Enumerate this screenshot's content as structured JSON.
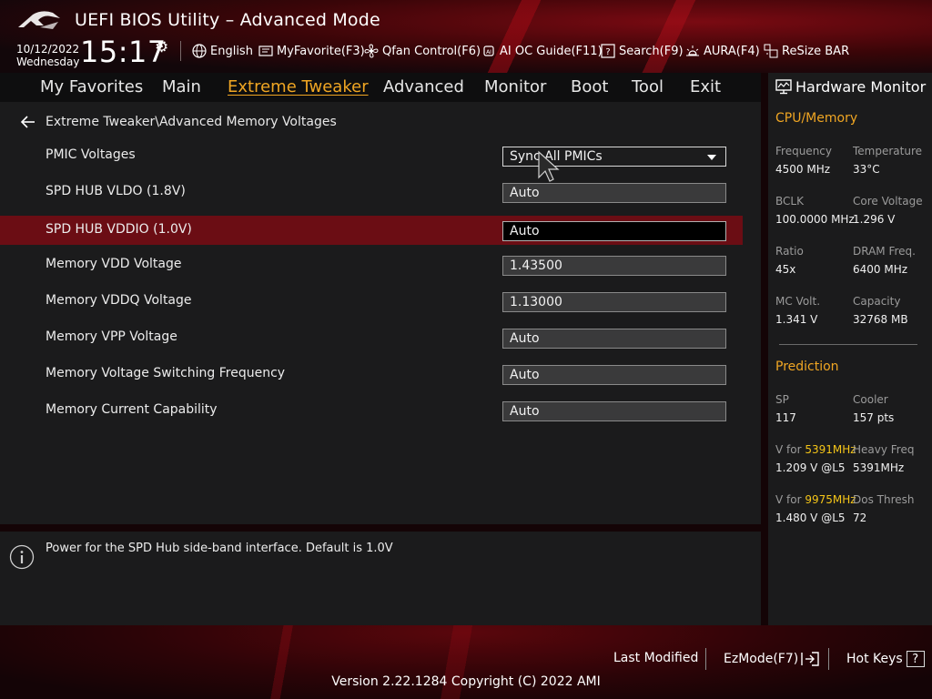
{
  "app": {
    "title": "UEFI BIOS Utility – Advanced Mode"
  },
  "header": {
    "date": "10/12/2022",
    "day": "Wednesday",
    "time": "15:17",
    "toolbar": [
      {
        "label": "English",
        "icon": "globe-icon"
      },
      {
        "label": "MyFavorite(F3)",
        "icon": "favorite-icon"
      },
      {
        "label": "Qfan Control(F6)",
        "icon": "fan-icon"
      },
      {
        "label": "AI OC Guide(F11)",
        "icon": "ai-chip-icon"
      },
      {
        "label": "Search(F9)",
        "icon": "search-help-icon"
      },
      {
        "label": "AURA(F4)",
        "icon": "aura-light-icon"
      },
      {
        "label": "ReSize BAR",
        "icon": "resize-bar-icon"
      }
    ]
  },
  "nav": {
    "tabs": [
      {
        "label": "My Favorites"
      },
      {
        "label": "Main"
      },
      {
        "label": "Extreme Tweaker",
        "active": true
      },
      {
        "label": "Advanced"
      },
      {
        "label": "Monitor"
      },
      {
        "label": "Boot"
      },
      {
        "label": "Tool"
      },
      {
        "label": "Exit"
      }
    ]
  },
  "main": {
    "breadcrumb": "Extreme Tweaker\\Advanced Memory Voltages",
    "settings": [
      {
        "label": "PMIC Voltages",
        "value": "Sync All PMICs",
        "type": "dropdown"
      },
      {
        "label": "SPD HUB VLDO (1.8V)",
        "value": "Auto"
      },
      {
        "label": "SPD HUB VDDIO (1.0V)",
        "value": "Auto",
        "selected": true
      },
      {
        "label": "Memory VDD Voltage",
        "value": "1.43500"
      },
      {
        "label": "Memory VDDQ Voltage",
        "value": "1.13000"
      },
      {
        "label": "Memory VPP Voltage",
        "value": "Auto"
      },
      {
        "label": "Memory Voltage Switching Frequency",
        "value": "Auto"
      },
      {
        "label": "Memory Current Capability",
        "value": "Auto"
      }
    ]
  },
  "help": {
    "text": "Power for the SPD Hub side-band interface. Default is 1.0V"
  },
  "hardware_monitor": {
    "title": "Hardware Monitor",
    "cpu_memory": {
      "heading": "CPU/Memory",
      "frequency_label": "Frequency",
      "frequency": "4500 MHz",
      "temperature_label": "Temperature",
      "temperature": "33°C",
      "bclk_label": "BCLK",
      "bclk": "100.0000 MHz",
      "core_voltage_label": "Core Voltage",
      "core_voltage": "1.296 V",
      "ratio_label": "Ratio",
      "ratio": "45x",
      "dram_freq_label": "DRAM Freq.",
      "dram_freq": "6400 MHz",
      "mc_volt_label": "MC Volt.",
      "mc_volt": "1.341 V",
      "capacity_label": "Capacity",
      "capacity": "32768 MB"
    },
    "prediction": {
      "heading": "Prediction",
      "sp_label": "SP",
      "sp": "117",
      "cooler_label": "Cooler",
      "cooler": "157 pts",
      "v_for_label": "V for",
      "v1_freq": "5391MHz",
      "v1_value": "1.209 V @L5",
      "heavy_freq_label": "Heavy Freq",
      "heavy_freq": "5391MHz",
      "v2_freq": "9975MHz",
      "v2_value": "1.480 V @L5",
      "dos_thresh_label": "Dos Thresh",
      "dos_thresh": "72"
    }
  },
  "footer": {
    "last_modified": "Last Modified",
    "ezmode": "EzMode(F7)",
    "hot_keys": "Hot Keys",
    "hot_keys_key": "?",
    "version": "Version 2.22.1284 Copyright (C) 2022 AMI"
  },
  "colors": {
    "accent": "#f0a623",
    "selected_row": "#6b0d14",
    "highlight": "#f5c518"
  }
}
